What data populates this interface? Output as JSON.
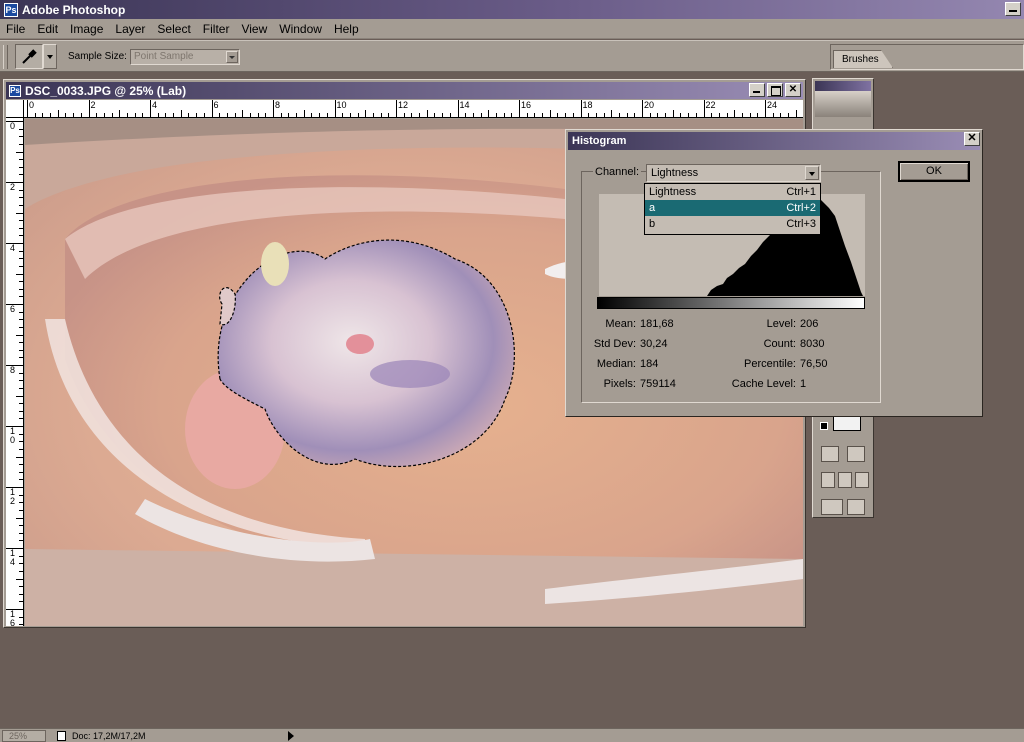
{
  "app": {
    "title": "Adobe Photoshop",
    "logo_icon": "photoshop-logo-icon"
  },
  "menu": [
    "File",
    "Edit",
    "Image",
    "Layer",
    "Select",
    "Filter",
    "View",
    "Window",
    "Help"
  ],
  "options": {
    "tool_icon": "eyedropper-icon",
    "sample_size_label": "Sample Size:",
    "sample_size_value": "Point Sample",
    "palette_tab": "Brushes"
  },
  "document": {
    "title": "DSC_0033.JPG @ 25% (Lab)",
    "ruler_h": [
      "0",
      "2",
      "4",
      "6",
      "8",
      "10",
      "12",
      "14",
      "16",
      "18",
      "20",
      "22",
      "24"
    ],
    "ruler_v": [
      "0",
      "2",
      "4",
      "6",
      "8",
      "1\n0",
      "1\n2",
      "1\n4",
      "1\n6"
    ]
  },
  "histogram": {
    "title": "Histogram",
    "channel_label": "Channel:",
    "channel_value": "Lightness",
    "ok_label": "OK",
    "dropdown": [
      {
        "label": "Lightness",
        "shortcut": "Ctrl+1",
        "selected": false
      },
      {
        "label": "a",
        "shortcut": "Ctrl+2",
        "selected": true
      },
      {
        "label": "b",
        "shortcut": "Ctrl+3",
        "selected": false
      }
    ],
    "stats_left": [
      {
        "label": "Mean:",
        "value": "181,68"
      },
      {
        "label": "Std Dev:",
        "value": "30,24"
      },
      {
        "label": "Median:",
        "value": "184"
      },
      {
        "label": "Pixels:",
        "value": "759114"
      }
    ],
    "stats_right": [
      {
        "label": "Level:",
        "value": "206"
      },
      {
        "label": "Count:",
        "value": "8030"
      },
      {
        "label": "Percentile:",
        "value": "76,50"
      },
      {
        "label": "Cache Level:",
        "value": "1"
      }
    ]
  },
  "status": {
    "zoom": "25%",
    "doc_size": "Doc: 17,2M/17,2M"
  },
  "colors": {
    "title_start": "#3b3555",
    "title_end": "#9a8db5",
    "selection": "#1a6a73",
    "chrome": "#a49c93"
  }
}
